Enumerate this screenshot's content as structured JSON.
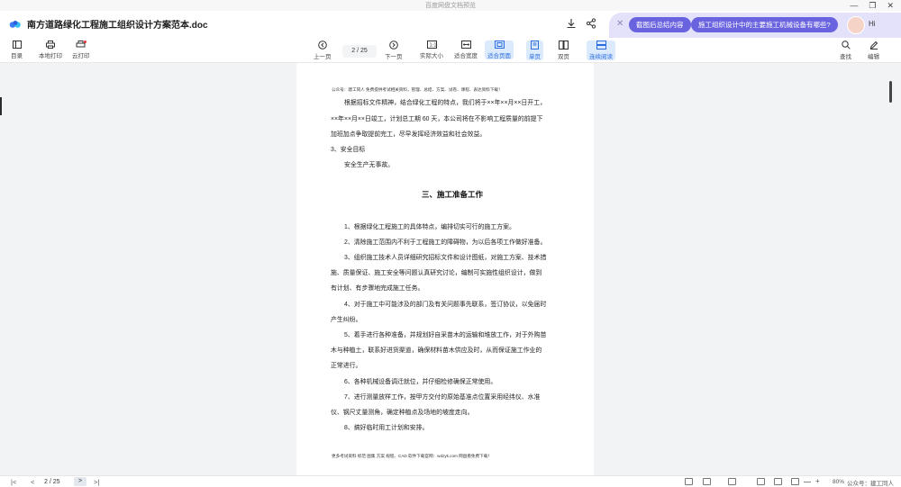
{
  "window": {
    "app_name": "百度网盘文档预览"
  },
  "document": {
    "title": "南方道路绿化工程施工组织设计方案范本.doc"
  },
  "ai_assistant": {
    "chip1": "截图后总结内容",
    "chip2": "施工组织设计中的主要施工机械设备有哪些?",
    "greeting": "Hi"
  },
  "toolbar": {
    "catalog": "目录",
    "local_print": "本地打印",
    "cloud_print": "云打印",
    "prev_page": "上一页",
    "page_indicator": "2 / 25",
    "next_page": "下一页",
    "actual_size": "实际大小",
    "fit_width": "适合宽度",
    "fit_page": "适合页面",
    "single_page": "单页",
    "double_page": "双页",
    "continuous": "连续阅读",
    "search": "查找",
    "edit": "编辑"
  },
  "page": {
    "header_note": "公众号：建工同人 免费提供考试相关资料，管理、总结、方案、试卷、课程、表达资料下载！",
    "para1_line1": "根据招标文件精神，结合绿化工程的特点，我们将于××年××月××日开工，",
    "para1_line2": "××年××月××日竣工，计划总工期 60 天，本公司将在不影响工程质量的前提下",
    "para1_line3": "加班加点争取提前完工，尽早发挥经济效益和社会效益。",
    "section3": "3、安全目标",
    "safety": "安全生产无事故。",
    "heading": "三、施工准备工作",
    "item1": "1、根据绿化工程施工的具体特点，编排切实可行的施工方案。",
    "item2": "2、清除施工范围内不利于工程施工的障碍物，为以后各项工作做好准备。",
    "item3_line1": "3、组织施工技术人员详细研究招标文件和设计图纸，对施工方案、技术措",
    "item3_line2": "施、质量保证、施工安全等问题认真研究讨论，编制可实施性组织设计，做到",
    "item3_line3": "有计划、有步骤地完成施工任务。",
    "item4_line1": "4、对于施工中可能涉及的部门及有关问题事先联系，签订协议，以免届时",
    "item4_line2": "产生纠纷。",
    "item5_line1": "5、着手进行各种准备，并规划好自采苗木的运输和堆放工作，对于外购苗",
    "item5_line2": "木与种植土，联系好进货渠道，确保材料苗木供应及时，从而保证施工作业的",
    "item5_line3": "正常进行。",
    "item6": "6、各种机械设备调迁就位，并仔细检修确保正常使用。",
    "item7_line1": "7、进行测量放样工作，按甲方交付的原始基准点位置采用经纬仪、水准",
    "item7_line2": "仪、钢尺丈量测角，确定种植点及场地的坡度走向。",
    "item8": "8、搞好临时用工计划和安排。",
    "footer_note": "更多考试资料 标范 图集 方案 规程、CAD 软件下载官网：wdzyk.com 网盘看免费下载！"
  },
  "statusbar": {
    "page_indicator": "2 / 25",
    "zoom": "80%",
    "watermark": "公众号：建工同人"
  }
}
